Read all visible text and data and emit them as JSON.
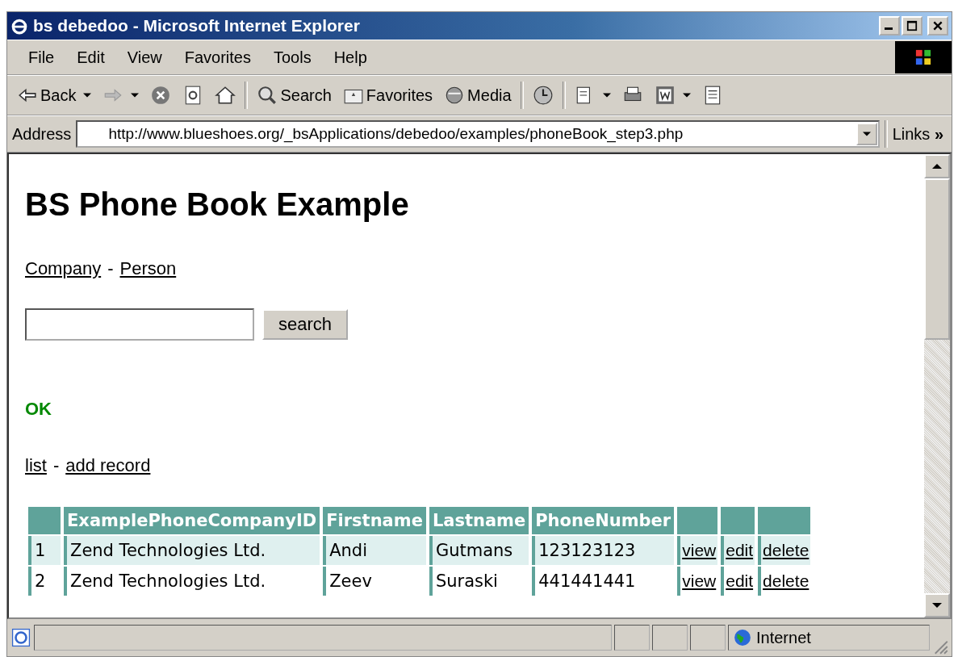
{
  "window": {
    "title": "bs debedoo - Microsoft Internet Explorer"
  },
  "menu": [
    "File",
    "Edit",
    "View",
    "Favorites",
    "Tools",
    "Help"
  ],
  "toolbar": [
    {
      "kind": "back",
      "label": "Back",
      "dropdown": true
    },
    {
      "kind": "forward",
      "dropdown": true
    },
    {
      "kind": "stop"
    },
    {
      "kind": "refresh"
    },
    {
      "kind": "home"
    },
    {
      "kind": "search",
      "label": "Search"
    },
    {
      "kind": "favorites",
      "label": "Favorites"
    },
    {
      "kind": "media",
      "label": "Media"
    },
    {
      "kind": "history"
    },
    {
      "kind": "mail",
      "dropdown": true
    },
    {
      "kind": "print"
    },
    {
      "kind": "word",
      "dropdown": true
    },
    {
      "kind": "discuss"
    }
  ],
  "address": {
    "label": "Address",
    "url": "http://www.blueshoes.org/_bsApplications/debedoo/examples/phoneBook_step3.php",
    "links": "Links",
    "links_chevron": "»"
  },
  "page": {
    "heading": "BS Phone Book Example",
    "nav": [
      "Company",
      "Person"
    ],
    "nav_separator": "-",
    "search": {
      "button": "search"
    },
    "status": "OK",
    "actions": [
      "list",
      "add record"
    ],
    "actions_separator": "-",
    "table": {
      "columns": [
        "",
        "ExamplePhoneCompanyID",
        "Firstname",
        "Lastname",
        "PhoneNumber",
        "",
        "",
        ""
      ],
      "rows": [
        {
          "cells": [
            "1",
            "Zend Technologies Ltd.",
            "Andi",
            "Gutmans",
            "123123123"
          ],
          "links": [
            "view",
            "edit",
            "delete"
          ]
        },
        {
          "cells": [
            "2",
            "Zend Technologies Ltd.",
            "Zeev",
            "Suraski",
            "441441441"
          ],
          "links": [
            "view",
            "edit",
            "delete"
          ]
        }
      ]
    }
  },
  "status_bar": {
    "zone": "Internet"
  }
}
